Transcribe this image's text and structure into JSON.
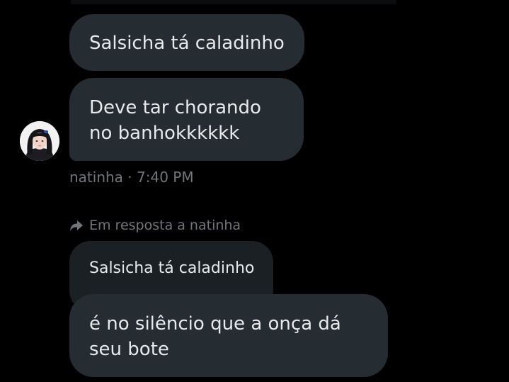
{
  "conversation": {
    "messages": [
      {
        "text": "Salsicha tá caladinho"
      },
      {
        "text": "Deve tar chorando no banhokkkkkk"
      }
    ],
    "meta": {
      "author": "natinha",
      "separator": "·",
      "time": "7:40 PM"
    },
    "reply": {
      "label": "Em resposta a natinha",
      "quoted_text": "Salsicha tá caladinho",
      "text": "é no silêncio que a onça dá seu bote"
    }
  },
  "colors": {
    "background": "#000000",
    "bubble": "#252d33",
    "quoted_bubble": "#1b2024",
    "muted_text": "#71767b",
    "text": "#e7e9ea"
  },
  "icons": {
    "reply": "reply-arrow-icon"
  }
}
